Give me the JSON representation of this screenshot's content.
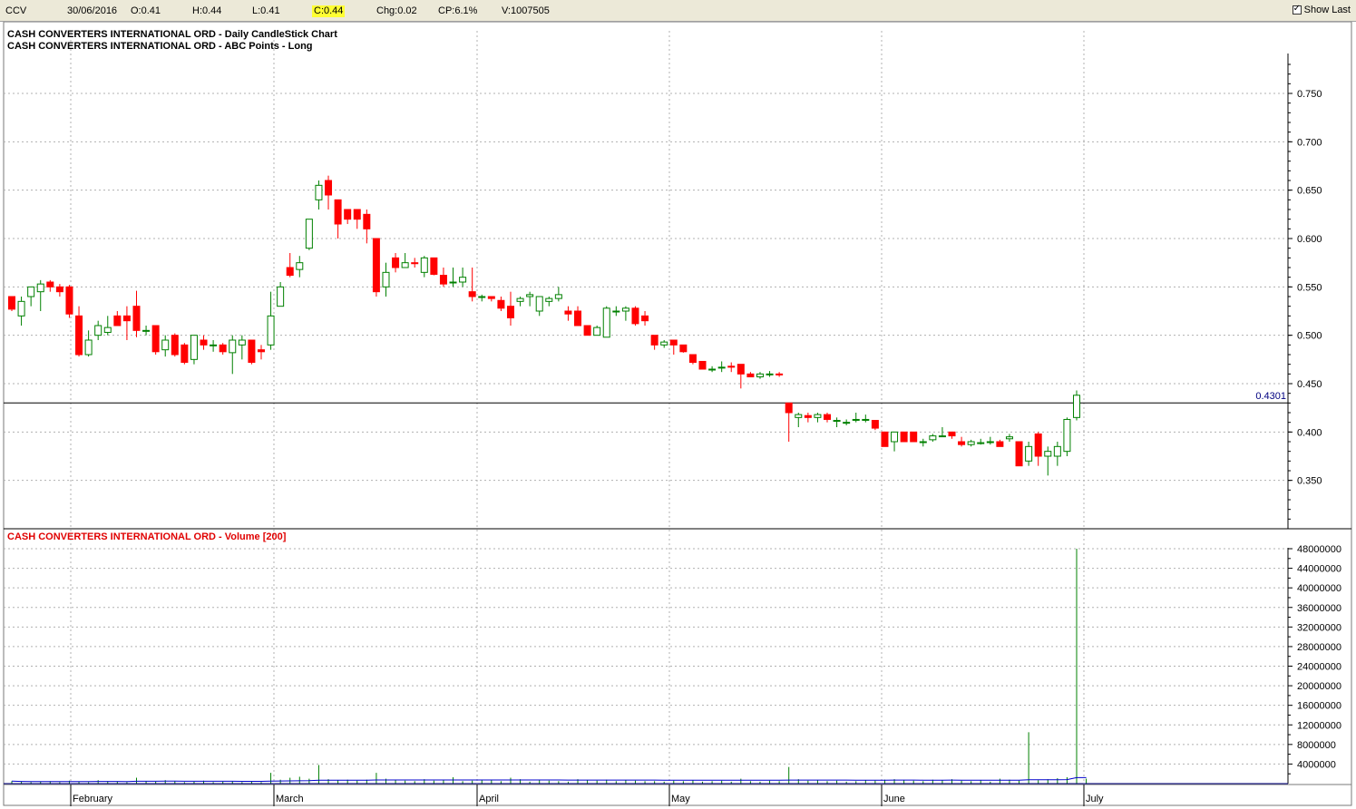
{
  "toolbar": {
    "symbol": "CCV",
    "date": "30/06/2016",
    "open": "O:0.41",
    "high": "H:0.44",
    "low": "L:0.41",
    "close": "C:0.44",
    "change": "Chg:0.02",
    "change_pct": "CP:6.1%",
    "volume": "V:1007505",
    "show_last_label": "Show Last",
    "show_last_checked": true,
    "highlight_color": "#ffff33"
  },
  "chart_data": [
    {
      "type": "candlestick",
      "title": "CASH CONVERTERS INTERNATIONAL ORD - Daily CandleStick Chart",
      "subtitle": "CASH CONVERTERS INTERNATIONAL ORD - ABC Points - Long",
      "ylim": [
        0.305,
        0.79
      ],
      "y_ticks": [
        "0.750",
        "0.700",
        "0.650",
        "0.600",
        "0.550",
        "0.500",
        "0.450",
        "0.400",
        "0.350"
      ],
      "reference_line": {
        "value": 0.4301,
        "label": "0.4301"
      },
      "x_ticks": [
        "February",
        "March",
        "April",
        "May",
        "June",
        "July"
      ],
      "grid": true,
      "up_color": "#008000",
      "down_color": "#ff0000",
      "candles": [
        {
          "o": 0.54,
          "h": 0.54,
          "l": 0.525,
          "c": 0.527
        },
        {
          "o": 0.52,
          "h": 0.54,
          "l": 0.51,
          "c": 0.535
        },
        {
          "o": 0.54,
          "h": 0.55,
          "l": 0.53,
          "c": 0.55
        },
        {
          "o": 0.545,
          "h": 0.557,
          "l": 0.525,
          "c": 0.553
        },
        {
          "o": 0.555,
          "h": 0.557,
          "l": 0.545,
          "c": 0.55
        },
        {
          "o": 0.55,
          "h": 0.553,
          "l": 0.54,
          "c": 0.545
        },
        {
          "o": 0.55,
          "h": 0.552,
          "l": 0.518,
          "c": 0.522
        },
        {
          "o": 0.52,
          "h": 0.53,
          "l": 0.478,
          "c": 0.48
        },
        {
          "o": 0.48,
          "h": 0.505,
          "l": 0.478,
          "c": 0.495
        },
        {
          "o": 0.5,
          "h": 0.515,
          "l": 0.495,
          "c": 0.51
        },
        {
          "o": 0.503,
          "h": 0.52,
          "l": 0.5,
          "c": 0.508
        },
        {
          "o": 0.52,
          "h": 0.525,
          "l": 0.51,
          "c": 0.51
        },
        {
          "o": 0.52,
          "h": 0.53,
          "l": 0.495,
          "c": 0.515
        },
        {
          "o": 0.53,
          "h": 0.546,
          "l": 0.498,
          "c": 0.505
        },
        {
          "o": 0.505,
          "h": 0.51,
          "l": 0.5,
          "c": 0.505
        },
        {
          "o": 0.51,
          "h": 0.51,
          "l": 0.48,
          "c": 0.483
        },
        {
          "o": 0.485,
          "h": 0.5,
          "l": 0.478,
          "c": 0.495
        },
        {
          "o": 0.5,
          "h": 0.502,
          "l": 0.478,
          "c": 0.48
        },
        {
          "o": 0.49,
          "h": 0.492,
          "l": 0.47,
          "c": 0.472
        },
        {
          "o": 0.475,
          "h": 0.5,
          "l": 0.47,
          "c": 0.5
        },
        {
          "o": 0.495,
          "h": 0.5,
          "l": 0.485,
          "c": 0.49
        },
        {
          "o": 0.49,
          "h": 0.495,
          "l": 0.483,
          "c": 0.49
        },
        {
          "o": 0.49,
          "h": 0.492,
          "l": 0.48,
          "c": 0.483
        },
        {
          "o": 0.482,
          "h": 0.5,
          "l": 0.46,
          "c": 0.495
        },
        {
          "o": 0.49,
          "h": 0.5,
          "l": 0.475,
          "c": 0.495
        },
        {
          "o": 0.495,
          "h": 0.495,
          "l": 0.47,
          "c": 0.472
        },
        {
          "o": 0.485,
          "h": 0.49,
          "l": 0.475,
          "c": 0.483
        },
        {
          "o": 0.49,
          "h": 0.545,
          "l": 0.485,
          "c": 0.52
        },
        {
          "o": 0.53,
          "h": 0.555,
          "l": 0.53,
          "c": 0.55
        },
        {
          "o": 0.57,
          "h": 0.585,
          "l": 0.56,
          "c": 0.562
        },
        {
          "o": 0.568,
          "h": 0.582,
          "l": 0.56,
          "c": 0.575
        },
        {
          "o": 0.59,
          "h": 0.62,
          "l": 0.588,
          "c": 0.62
        },
        {
          "o": 0.64,
          "h": 0.66,
          "l": 0.63,
          "c": 0.655
        },
        {
          "o": 0.66,
          "h": 0.665,
          "l": 0.63,
          "c": 0.645
        },
        {
          "o": 0.64,
          "h": 0.64,
          "l": 0.6,
          "c": 0.615
        },
        {
          "o": 0.63,
          "h": 0.63,
          "l": 0.615,
          "c": 0.62
        },
        {
          "o": 0.63,
          "h": 0.63,
          "l": 0.61,
          "c": 0.62
        },
        {
          "o": 0.625,
          "h": 0.63,
          "l": 0.595,
          "c": 0.61
        },
        {
          "o": 0.6,
          "h": 0.6,
          "l": 0.54,
          "c": 0.545
        },
        {
          "o": 0.55,
          "h": 0.575,
          "l": 0.54,
          "c": 0.565
        },
        {
          "o": 0.58,
          "h": 0.585,
          "l": 0.565,
          "c": 0.57
        },
        {
          "o": 0.57,
          "h": 0.585,
          "l": 0.57,
          "c": 0.575
        },
        {
          "o": 0.575,
          "h": 0.58,
          "l": 0.57,
          "c": 0.574
        },
        {
          "o": 0.565,
          "h": 0.582,
          "l": 0.56,
          "c": 0.58
        },
        {
          "o": 0.58,
          "h": 0.58,
          "l": 0.562,
          "c": 0.563
        },
        {
          "o": 0.562,
          "h": 0.57,
          "l": 0.55,
          "c": 0.553
        },
        {
          "o": 0.555,
          "h": 0.57,
          "l": 0.55,
          "c": 0.555
        },
        {
          "o": 0.555,
          "h": 0.57,
          "l": 0.55,
          "c": 0.56
        },
        {
          "o": 0.545,
          "h": 0.57,
          "l": 0.535,
          "c": 0.54
        },
        {
          "o": 0.54,
          "h": 0.542,
          "l": 0.535,
          "c": 0.54
        },
        {
          "o": 0.54,
          "h": 0.54,
          "l": 0.535,
          "c": 0.538
        },
        {
          "o": 0.536,
          "h": 0.54,
          "l": 0.525,
          "c": 0.528
        },
        {
          "o": 0.53,
          "h": 0.545,
          "l": 0.51,
          "c": 0.518
        },
        {
          "o": 0.535,
          "h": 0.54,
          "l": 0.53,
          "c": 0.538
        },
        {
          "o": 0.54,
          "h": 0.545,
          "l": 0.53,
          "c": 0.542
        },
        {
          "o": 0.525,
          "h": 0.54,
          "l": 0.52,
          "c": 0.54
        },
        {
          "o": 0.535,
          "h": 0.54,
          "l": 0.53,
          "c": 0.538
        },
        {
          "o": 0.538,
          "h": 0.55,
          "l": 0.535,
          "c": 0.542
        },
        {
          "o": 0.525,
          "h": 0.53,
          "l": 0.515,
          "c": 0.522
        },
        {
          "o": 0.525,
          "h": 0.53,
          "l": 0.51,
          "c": 0.51
        },
        {
          "o": 0.51,
          "h": 0.51,
          "l": 0.5,
          "c": 0.5
        },
        {
          "o": 0.5,
          "h": 0.51,
          "l": 0.5,
          "c": 0.508
        },
        {
          "o": 0.498,
          "h": 0.53,
          "l": 0.498,
          "c": 0.528
        },
        {
          "o": 0.525,
          "h": 0.53,
          "l": 0.52,
          "c": 0.525
        },
        {
          "o": 0.525,
          "h": 0.53,
          "l": 0.515,
          "c": 0.528
        },
        {
          "o": 0.528,
          "h": 0.53,
          "l": 0.51,
          "c": 0.512
        },
        {
          "o": 0.52,
          "h": 0.525,
          "l": 0.51,
          "c": 0.515
        },
        {
          "o": 0.5,
          "h": 0.5,
          "l": 0.485,
          "c": 0.49
        },
        {
          "o": 0.49,
          "h": 0.495,
          "l": 0.487,
          "c": 0.493
        },
        {
          "o": 0.495,
          "h": 0.495,
          "l": 0.48,
          "c": 0.49
        },
        {
          "o": 0.49,
          "h": 0.49,
          "l": 0.482,
          "c": 0.483
        },
        {
          "o": 0.48,
          "h": 0.48,
          "l": 0.47,
          "c": 0.472
        },
        {
          "o": 0.473,
          "h": 0.473,
          "l": 0.465,
          "c": 0.465
        },
        {
          "o": 0.465,
          "h": 0.468,
          "l": 0.462,
          "c": 0.465
        },
        {
          "o": 0.467,
          "h": 0.473,
          "l": 0.462,
          "c": 0.467
        },
        {
          "o": 0.468,
          "h": 0.472,
          "l": 0.462,
          "c": 0.467
        },
        {
          "o": 0.47,
          "h": 0.47,
          "l": 0.445,
          "c": 0.46
        },
        {
          "o": 0.46,
          "h": 0.462,
          "l": 0.457,
          "c": 0.457
        },
        {
          "o": 0.457,
          "h": 0.462,
          "l": 0.455,
          "c": 0.46
        },
        {
          "o": 0.46,
          "h": 0.463,
          "l": 0.457,
          "c": 0.46
        },
        {
          "o": 0.46,
          "h": 0.462,
          "l": 0.457,
          "c": 0.459
        },
        {
          "o": 0.43,
          "h": 0.43,
          "l": 0.39,
          "c": 0.42
        },
        {
          "o": 0.415,
          "h": 0.42,
          "l": 0.405,
          "c": 0.418
        },
        {
          "o": 0.417,
          "h": 0.42,
          "l": 0.41,
          "c": 0.415
        },
        {
          "o": 0.415,
          "h": 0.42,
          "l": 0.41,
          "c": 0.418
        },
        {
          "o": 0.418,
          "h": 0.42,
          "l": 0.41,
          "c": 0.413
        },
        {
          "o": 0.412,
          "h": 0.415,
          "l": 0.405,
          "c": 0.412
        },
        {
          "o": 0.41,
          "h": 0.413,
          "l": 0.407,
          "c": 0.41
        },
        {
          "o": 0.413,
          "h": 0.42,
          "l": 0.41,
          "c": 0.413
        },
        {
          "o": 0.413,
          "h": 0.418,
          "l": 0.41,
          "c": 0.413
        },
        {
          "o": 0.412,
          "h": 0.412,
          "l": 0.402,
          "c": 0.404
        },
        {
          "o": 0.4,
          "h": 0.4,
          "l": 0.385,
          "c": 0.385
        },
        {
          "o": 0.39,
          "h": 0.4,
          "l": 0.38,
          "c": 0.4
        },
        {
          "o": 0.4,
          "h": 0.4,
          "l": 0.39,
          "c": 0.39
        },
        {
          "o": 0.4,
          "h": 0.4,
          "l": 0.39,
          "c": 0.39
        },
        {
          "o": 0.39,
          "h": 0.393,
          "l": 0.385,
          "c": 0.39
        },
        {
          "o": 0.392,
          "h": 0.398,
          "l": 0.39,
          "c": 0.396
        },
        {
          "o": 0.396,
          "h": 0.405,
          "l": 0.395,
          "c": 0.396
        },
        {
          "o": 0.4,
          "h": 0.4,
          "l": 0.393,
          "c": 0.396
        },
        {
          "o": 0.39,
          "h": 0.395,
          "l": 0.385,
          "c": 0.387
        },
        {
          "o": 0.387,
          "h": 0.392,
          "l": 0.385,
          "c": 0.39
        },
        {
          "o": 0.388,
          "h": 0.393,
          "l": 0.387,
          "c": 0.389
        },
        {
          "o": 0.39,
          "h": 0.395,
          "l": 0.387,
          "c": 0.39
        },
        {
          "o": 0.39,
          "h": 0.392,
          "l": 0.385,
          "c": 0.385
        },
        {
          "o": 0.393,
          "h": 0.398,
          "l": 0.39,
          "c": 0.395
        },
        {
          "o": 0.39,
          "h": 0.39,
          "l": 0.365,
          "c": 0.365
        },
        {
          "o": 0.37,
          "h": 0.39,
          "l": 0.365,
          "c": 0.385
        },
        {
          "o": 0.398,
          "h": 0.4,
          "l": 0.365,
          "c": 0.375
        },
        {
          "o": 0.375,
          "h": 0.385,
          "l": 0.355,
          "c": 0.38
        },
        {
          "o": 0.375,
          "h": 0.39,
          "l": 0.365,
          "c": 0.385
        },
        {
          "o": 0.38,
          "h": 0.415,
          "l": 0.375,
          "c": 0.413
        },
        {
          "o": 0.415,
          "h": 0.443,
          "l": 0.412,
          "c": 0.438
        }
      ]
    },
    {
      "type": "bar",
      "title": "CASH CONVERTERS INTERNATIONAL ORD - Volume [200]",
      "ylim": [
        0,
        50000000
      ],
      "y_ticks": [
        "48000000",
        "44000000",
        "40000000",
        "36000000",
        "32000000",
        "28000000",
        "24000000",
        "20000000",
        "16000000",
        "12000000",
        "8000000",
        "4000000"
      ],
      "grid": true,
      "bar_color": "#008000",
      "ma_color": "#0000cc",
      "values": [
        500000,
        400000,
        300000,
        400000,
        500000,
        300000,
        600000,
        400000,
        300000,
        700000,
        500000,
        400000,
        300000,
        1200000,
        500000,
        400000,
        700000,
        500000,
        300000,
        400000,
        600000,
        300000,
        400000,
        500000,
        300000,
        400000,
        300000,
        2200000,
        800000,
        1200000,
        1400000,
        1000000,
        3800000,
        900000,
        700000,
        800000,
        600000,
        800000,
        2200000,
        1000000,
        700000,
        600000,
        500000,
        900000,
        600000,
        700000,
        1300000,
        500000,
        600000,
        800000,
        700000,
        500000,
        1200000,
        900000,
        400000,
        800000,
        600000,
        500000,
        400000,
        900000,
        700000,
        600000,
        800000,
        500000,
        700000,
        600000,
        500000,
        500000,
        400000,
        600000,
        500000,
        700000,
        400000,
        500000,
        600000,
        400000,
        1000000,
        500000,
        400000,
        600000,
        500000,
        3400000,
        900000,
        600000,
        700000,
        500000,
        600000,
        400000,
        500000,
        700000,
        600000,
        800000,
        900000,
        700000,
        600000,
        500000,
        800000,
        700000,
        900000,
        600000,
        500000,
        700000,
        400000,
        1000000,
        800000,
        600000,
        10500000,
        700000,
        900000,
        1100000,
        1300000,
        48000000,
        1007505
      ]
    }
  ]
}
